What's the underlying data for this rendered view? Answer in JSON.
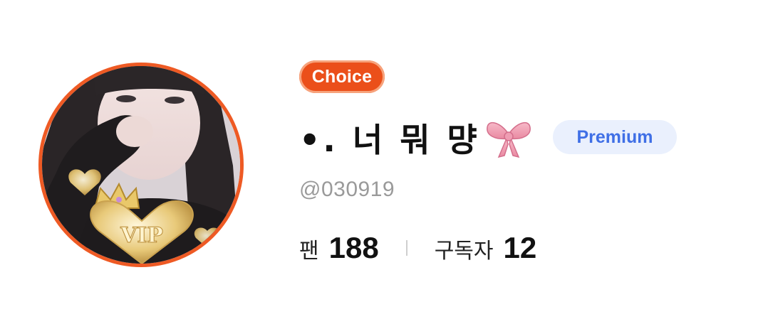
{
  "profile": {
    "badge_label": "Choice",
    "display_name": "•. 너 뭐 먕",
    "name_emoji": "bow-icon",
    "tier_label": "Premium",
    "handle": "@030919",
    "avatar_overlay_text": "VIP"
  },
  "stats": [
    {
      "label": "팬",
      "value": "188"
    },
    {
      "label": "구독자",
      "value": "12"
    }
  ],
  "colors": {
    "avatar_ring": "#ee5a24",
    "choice_badge_bg": "#eb4f1a",
    "premium_badge_bg": "#eaf0fd",
    "premium_badge_text": "#3f6fe6",
    "handle_text": "#9a9a9a"
  }
}
